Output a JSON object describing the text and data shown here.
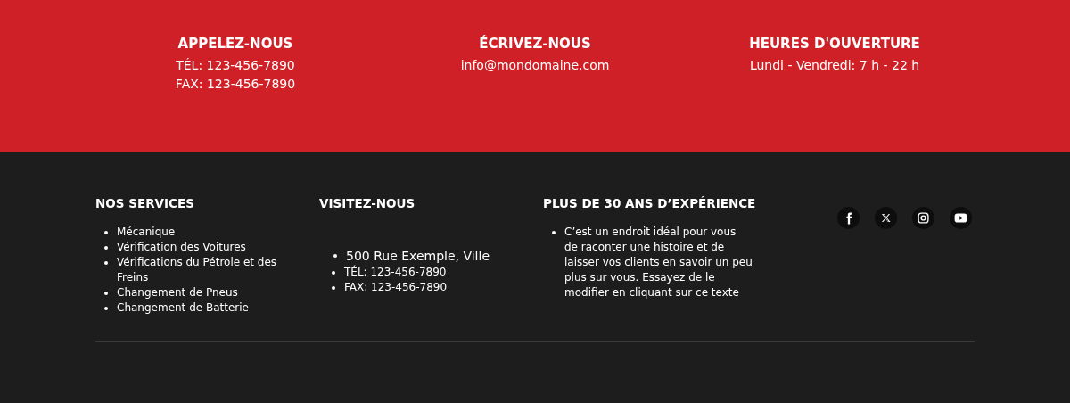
{
  "contact": [
    {
      "title": "APPELEZ-NOUS",
      "lines": [
        "TÉL: 123-456-7890",
        "FAX: 123-456-7890"
      ]
    },
    {
      "title": "ÉCRIVEZ-NOUS",
      "lines": [
        "info@mondomaine.com"
      ]
    },
    {
      "title": "HEURES D'OUVERTURE",
      "lines": [
        "Lundi - Vendredi: 7 h - 22 h"
      ]
    }
  ],
  "footer": {
    "services": {
      "title": "NOS SERVICES",
      "items": [
        "Mécanique",
        "Vérification des Voitures",
        "Vérifications du Pétrole et des Freins",
        "Changement de Pneus",
        "Changement de Batterie"
      ]
    },
    "visit": {
      "title": "VISITEZ-NOUS",
      "address": "500 Rue Exemple, Ville",
      "items": [
        "TÉL: 123-456-7890",
        "FAX: 123-456-7890"
      ]
    },
    "about": {
      "title": "PLUS DE 30 ANS D’EXPÉRIENCE",
      "items": [
        "C’est un endroit idéal pour vous de raconter une histoire et de laisser vos clients en savoir un peu plus sur vous. Essayez de le modifier en cliquant sur ce texte"
      ]
    },
    "social": [
      {
        "kind": "facebook"
      },
      {
        "kind": "x"
      },
      {
        "kind": "instagram"
      },
      {
        "kind": "youtube"
      }
    ]
  }
}
